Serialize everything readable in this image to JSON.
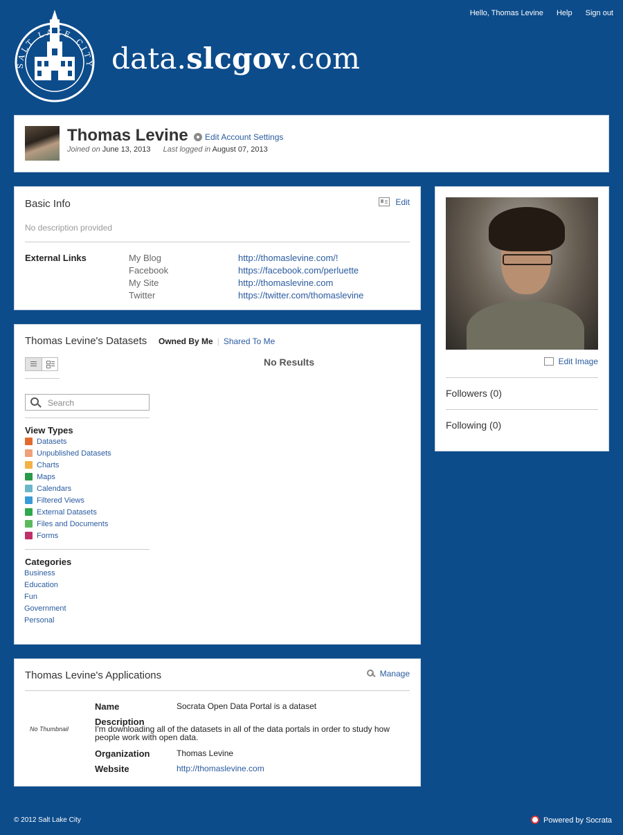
{
  "topnav": {
    "greeting": "Hello, Thomas Levine",
    "help": "Help",
    "signout": "Sign out"
  },
  "brand": {
    "seal_name": "SALT LAKE CITY",
    "prefix": "data.",
    "bold": "slcgov",
    "suffix": ".com"
  },
  "profile": {
    "name": "Thomas Levine",
    "edit_settings": "Edit Account Settings",
    "joined_label": "Joined on",
    "joined_date": "June 13, 2013",
    "last_label": "Last logged in",
    "last_date": "August 07, 2013"
  },
  "basic": {
    "title": "Basic Info",
    "edit": "Edit",
    "description": "No description provided",
    "external_label": "External Links",
    "links": [
      {
        "name": "My Blog",
        "url": "http://thomaslevine.com/!"
      },
      {
        "name": "Facebook",
        "url": "https://facebook.com/perluette"
      },
      {
        "name": "My Site",
        "url": "http://thomaslevine.com"
      },
      {
        "name": "Twitter",
        "url": "https://twitter.com/thomaslevine"
      }
    ]
  },
  "side": {
    "edit_image": "Edit Image",
    "followers": "Followers (0)",
    "following": "Following (0)"
  },
  "datasets": {
    "title": "Thomas Levine's Datasets",
    "tab_owned": "Owned By Me",
    "tab_shared": "Shared To Me",
    "no_results": "No Results",
    "search_placeholder": "Search",
    "view_types_title": "View Types",
    "view_types": [
      {
        "label": "Datasets",
        "color": "#e36a2e"
      },
      {
        "label": "Unpublished Datasets",
        "color": "#f0a07a"
      },
      {
        "label": "Charts",
        "color": "#f5b244"
      },
      {
        "label": "Maps",
        "color": "#2a9a4a"
      },
      {
        "label": "Calendars",
        "color": "#6bb7c9"
      },
      {
        "label": "Filtered Views",
        "color": "#3a9bd6"
      },
      {
        "label": "External Datasets",
        "color": "#2fa84f"
      },
      {
        "label": "Files and Documents",
        "color": "#5cb85c"
      },
      {
        "label": "Forms",
        "color": "#c0306b"
      }
    ],
    "categories_title": "Categories",
    "categories": [
      "Business",
      "Education",
      "Fun",
      "Government",
      "Personal"
    ]
  },
  "apps": {
    "title": "Thomas Levine's Applications",
    "manage": "Manage",
    "no_thumbnail": "No Thumbnail",
    "name_label": "Name",
    "name_value": "Socrata Open Data Portal is a dataset",
    "description_label": "Description",
    "description_value": "I'm downloading all of the datasets in all of the data portals in order to study how people work with open data.",
    "organization_label": "Organization",
    "organization_value": "Thomas Levine",
    "website_label": "Website",
    "website_value": "http://thomaslevine.com"
  },
  "footer": {
    "copyright": "© 2012 Salt Lake City",
    "powered": "Powered by Socrata"
  },
  "colors": {
    "background": "#0d4c8b",
    "link": "#2a5b9f"
  }
}
